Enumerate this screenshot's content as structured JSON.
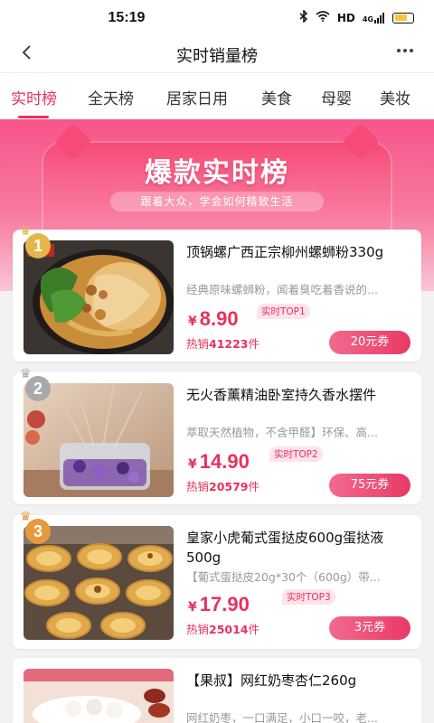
{
  "status": {
    "time": "15:19",
    "network": "HD",
    "signal": "4G"
  },
  "header": {
    "title": "实时销量榜",
    "back_icon": "chevron-left-icon",
    "more_icon": "more-dots-icon"
  },
  "tabs": [
    {
      "label": "实时榜",
      "active": true
    },
    {
      "label": "全天榜"
    },
    {
      "label": "居家日用"
    },
    {
      "label": "美食"
    },
    {
      "label": "母婴"
    },
    {
      "label": "美妆"
    }
  ],
  "banner": {
    "title": "爆款实时榜",
    "subtitle": "跟着大众，学会如何精致生活"
  },
  "colors": {
    "accent": "#e9315c",
    "banner": "#f7558a",
    "rank1": "#e5b64c",
    "rank2": "#a9a9a9",
    "rank3": "#e69a3d"
  },
  "products": [
    {
      "rank": "1",
      "thumb_label": "螺",
      "title": "顶锅螺广西正宗柳州螺蛳粉330g",
      "desc": "经典原味螺蛳粉，闻着臭吃着香说的...",
      "price": "8.90",
      "currency": "¥",
      "top_tag": "实时TOP1",
      "sold_prefix": "热销",
      "sold_count": "41223",
      "sold_suffix": "件",
      "coupon": "20元券"
    },
    {
      "rank": "2",
      "title": "无火香薰精油卧室持久香水摆件",
      "desc": "萃取天然植物，不含甲醛】环保、高...",
      "price": "14.90",
      "currency": "¥",
      "top_tag": "实时TOP2",
      "sold_prefix": "热销",
      "sold_count": "20579",
      "sold_suffix": "件",
      "coupon": "75元券"
    },
    {
      "rank": "3",
      "title": "皇家小虎葡式蛋挞皮600g蛋挞液500g",
      "desc": "【葡式蛋挞皮20g*30个（600g）带...",
      "price": "17.90",
      "currency": "¥",
      "top_tag": "实时TOP3",
      "sold_prefix": "热销",
      "sold_count": "25014",
      "sold_suffix": "件",
      "coupon": "3元券"
    },
    {
      "title": "【果叔】网红奶枣杏仁260g",
      "desc": "网红奶枣，一口满足，小口一咬，老..."
    }
  ]
}
